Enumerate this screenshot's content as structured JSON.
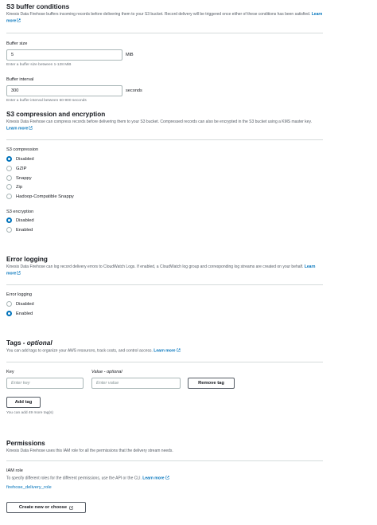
{
  "s3_buffer": {
    "title": "S3 buffer conditions",
    "description": "Kinesis Data Firehose buffers incoming records before delivering them to your S3 bucket. Record delivery will be triggered once either of these conditions has been satisfied.",
    "learn_more": "Learn more",
    "buffer_size": {
      "label": "Buffer size",
      "value": "5",
      "unit": "MiB",
      "hint": "Enter a buffer size between 1-128 MiB"
    },
    "buffer_interval": {
      "label": "Buffer interval",
      "value": "300",
      "unit": "seconds",
      "hint": "Enter a buffer interval between 60-900 seconds"
    }
  },
  "s3_compression": {
    "title": "S3 compression and encryption",
    "description": "Kinesis Data Firehose can compress records before delivering them to your S3 bucket. Compressed records can also be encrypted in the S3 bucket using a KMS master key.",
    "learn_more": "Learn more",
    "compression": {
      "label": "S3 compression",
      "options": [
        "Disabled",
        "GZIP",
        "Snappy",
        "Zip",
        "Hadoop-Compatible Snappy"
      ],
      "selected": "Disabled"
    },
    "encryption": {
      "label": "S3 encryption",
      "options": [
        "Disabled",
        "Enabled"
      ],
      "selected": "Disabled"
    }
  },
  "error_logging": {
    "title": "Error logging",
    "description": "Kinesis Data Firehose can log record delivery errors to CloudWatch Logs. If enabled, a CloudWatch log group and corresponding log streams are created on your behalf.",
    "learn_more": "Learn more",
    "label": "Error logging",
    "options": [
      "Disabled",
      "Enabled"
    ],
    "selected": "Enabled"
  },
  "tags": {
    "title": "Tags",
    "title_suffix": "- optional",
    "description": "You can add tags to organize your AWS resources, track costs, and control access.",
    "learn_more": "Learn more",
    "key_label": "Key",
    "value_label": "Value - optional",
    "key_placeholder": "Enter key",
    "value_placeholder": "Enter value",
    "remove_button": "Remove tag",
    "add_button": "Add tag",
    "remaining": "You can add 49 more tag(s)"
  },
  "permissions": {
    "title": "Permissions",
    "description": "Kinesis Data Firehose uses this IAM role for all the permissions that the delivery stream needs.",
    "iam_label": "IAM role",
    "iam_hint": "To specify different roles for the different permissions, use the API or the CLI.",
    "learn_more": "Learn more",
    "role_link": "firehose_delivery_role",
    "create_button": "Create new or choose"
  },
  "colors": {
    "link": "#0073bb",
    "radio_selected": "#0073bb",
    "text": "#16191f",
    "muted": "#545b64",
    "divider": "#d5dbdb"
  },
  "icons": [
    "external-link-icon"
  ]
}
